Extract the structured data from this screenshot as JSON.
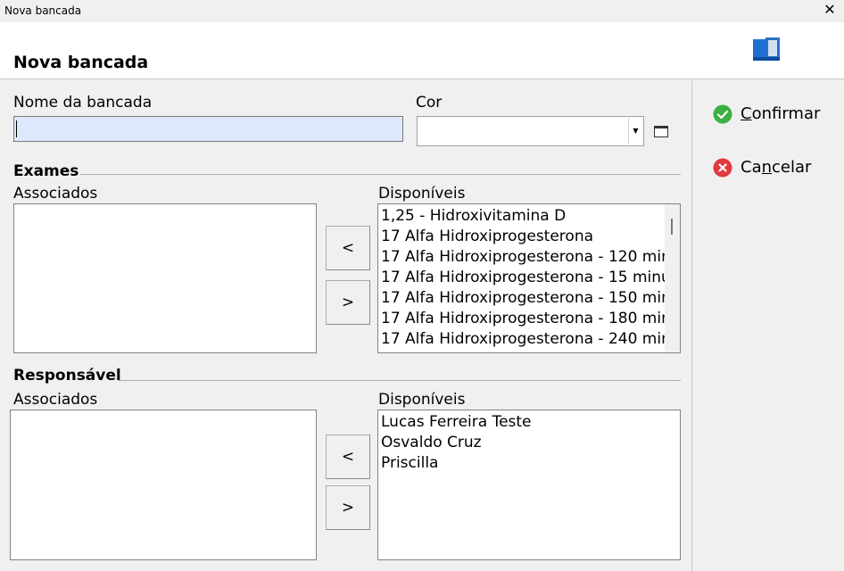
{
  "window": {
    "title": "Nova bancada",
    "close_glyph": "✕"
  },
  "header": {
    "heading": "Nova bancada",
    "logo_icon": "book-logo-icon"
  },
  "form": {
    "name_label": "Nome da bancada",
    "name_value": "",
    "color_label": "Cor",
    "color_value": ""
  },
  "exames": {
    "title": "Exames",
    "associated_label": "Associados",
    "available_label": "Disponíveis",
    "associated_items": [],
    "available_items": [
      "1,25 - Hidroxivitamina D",
      "17 Alfa Hidroxiprogesterona",
      "17 Alfa Hidroxiprogesterona - 120 min",
      "17 Alfa Hidroxiprogesterona - 15 minu",
      "17 Alfa Hidroxiprogesterona - 150 min",
      "17 Alfa Hidroxiprogesterona - 180 min",
      "17 Alfa Hidroxiprogesterona - 240 min"
    ],
    "move_left": "<",
    "move_right": ">"
  },
  "responsavel": {
    "title": "Responsável",
    "associated_label": "Associados",
    "available_label": "Disponíveis",
    "associated_items": [],
    "available_items": [
      "Lucas Ferreira Teste",
      "Osvaldo Cruz",
      "Priscilla"
    ],
    "move_left": "<",
    "move_right": ">"
  },
  "actions": {
    "confirm_first": "C",
    "confirm_rest": "onfirmar",
    "cancel_pre": "Ca",
    "cancel_mid": "n",
    "cancel_rest": "celar",
    "confirm_color": "#3cb043",
    "cancel_color": "#e0393e"
  }
}
